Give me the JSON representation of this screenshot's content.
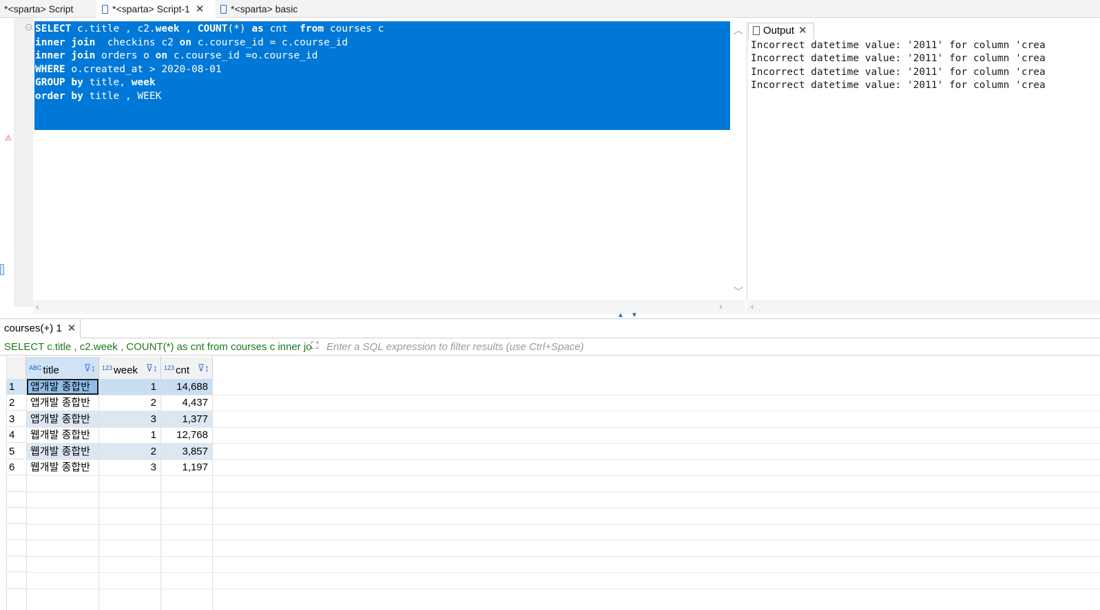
{
  "tabs": [
    {
      "label": "*<sparta> Script"
    },
    {
      "label": "*<sparta> Script-1"
    },
    {
      "label": "*<sparta> basic"
    }
  ],
  "sql": {
    "lines": [
      "SELECT c.title , c2.week , COUNT(*) as cnt  from courses c",
      "inner join  checkins c2 on c.course_id = c.course_id",
      "inner join orders o on c.course_id =o.course_id",
      "WHERE o.created_at > 2020-08-01",
      "GROUP by title, week",
      "order by title , WEEK"
    ]
  },
  "output": {
    "tab_label": "Output",
    "lines": [
      "Incorrect datetime value: '2011' for column 'crea",
      "Incorrect datetime value: '2011' for column 'crea",
      "Incorrect datetime value: '2011' for column 'crea",
      "Incorrect datetime value: '2011' for column 'crea"
    ]
  },
  "results": {
    "tab_label": "courses(+) 1",
    "query_preview": "SELECT c.title , c2.week , COUNT(*) as cnt from courses c inner jo",
    "filter_placeholder": "Enter a SQL expression to filter results (use Ctrl+Space)",
    "columns": [
      {
        "name": "title",
        "type_badge": "ABC"
      },
      {
        "name": "week",
        "type_badge": "123"
      },
      {
        "name": "cnt",
        "type_badge": "123"
      }
    ],
    "rows": [
      {
        "num": "1",
        "title": "앱개발 종합반",
        "week": "1",
        "cnt": "14,688"
      },
      {
        "num": "2",
        "title": "앱개발 종합반",
        "week": "2",
        "cnt": "4,437"
      },
      {
        "num": "3",
        "title": "앱개발 종합반",
        "week": "3",
        "cnt": "1,377"
      },
      {
        "num": "4",
        "title": "웹개발 종합반",
        "week": "1",
        "cnt": "12,768"
      },
      {
        "num": "5",
        "title": "웹개발 종합반",
        "week": "2",
        "cnt": "3,857"
      },
      {
        "num": "6",
        "title": "웹개발 종합반",
        "week": "3",
        "cnt": "1,197"
      }
    ]
  }
}
